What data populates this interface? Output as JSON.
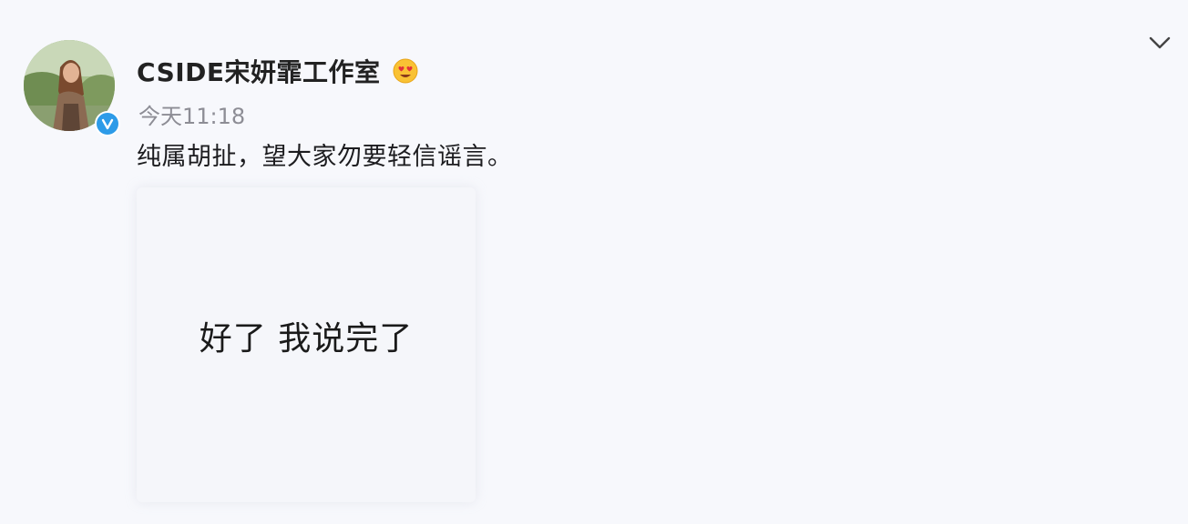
{
  "post": {
    "username": "CSIDE宋妍霏工作室",
    "timestamp": "今天11:18",
    "text": "纯属胡扯，望大家勿要轻信谣言。",
    "image_text": "好了 我说完了"
  },
  "icons": {
    "verified": "verified-badge-icon",
    "emoji": "heart-eyes-emoji-icon",
    "menu": "chevron-down-icon"
  },
  "colors": {
    "background": "#f7f8fc",
    "verified_blue": "#2d9be8",
    "emoji_yellow": "#f9c234",
    "timestamp_gray": "#8d8d95"
  }
}
